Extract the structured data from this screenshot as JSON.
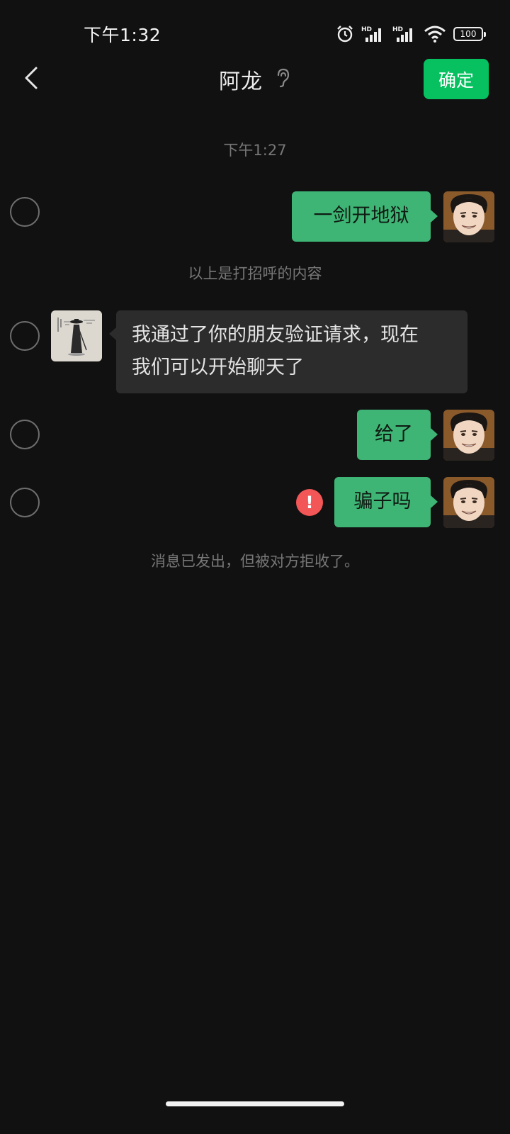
{
  "status_bar": {
    "time": "下午1:32",
    "battery": "100",
    "icons": [
      "alarm-icon",
      "hd-signal-icon",
      "hd-signal-icon",
      "wifi-icon",
      "battery-icon"
    ]
  },
  "header": {
    "title": "阿龙",
    "confirm_label": "确定",
    "back_icon": "chevron-left-icon",
    "ear_icon": "ear-icon"
  },
  "chat": {
    "timestamp": "下午1:27",
    "greeting_note": "以上是打招呼的内容",
    "rejected_note": "消息已发出，但被对方拒收了。",
    "messages": [
      {
        "direction": "out",
        "text": "一剑开地狱"
      },
      {
        "direction": "in",
        "line1": "我通过了你的朋友验证请求，现在",
        "line2": "我们可以开始聊天了"
      },
      {
        "direction": "out",
        "text": "给了"
      },
      {
        "direction": "out",
        "text": "骗子吗",
        "error": true,
        "error_glyph": "!"
      }
    ]
  },
  "colors": {
    "background": "#111111",
    "accent_green": "#07c160",
    "out_bubble": "#3eb575",
    "in_bubble": "#2c2c2c",
    "error": "#f25656"
  }
}
